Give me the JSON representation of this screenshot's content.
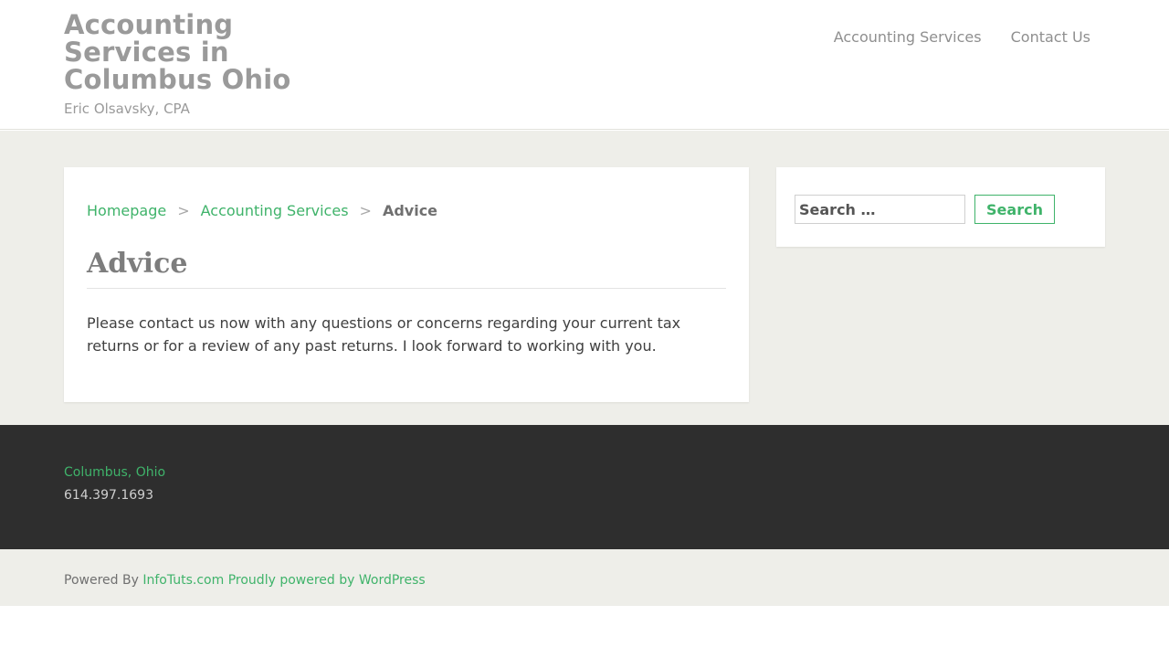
{
  "header": {
    "site_title": "Accounting Services in Columbus Ohio",
    "site_description": "Eric Olsavsky, CPA",
    "nav": [
      {
        "label": "Accounting Services"
      },
      {
        "label": "Contact Us"
      }
    ]
  },
  "breadcrumb": {
    "items": [
      "Homepage",
      "Accounting Services"
    ],
    "separator": ">",
    "current": "Advice"
  },
  "entry": {
    "title": "Advice",
    "content": "Please contact us now with any questions or concerns regarding your current tax returns or for a review of any past returns. I look forward to working with you."
  },
  "sidebar": {
    "search": {
      "placeholder": "Search …",
      "button_label": "Search"
    }
  },
  "footer": {
    "city": "Columbus, Ohio",
    "phone": "614.397.1693",
    "powered_prefix": "Powered By",
    "powered_link": "InfoTuts.com",
    "wordpress_link": "Proudly powered by WordPress"
  },
  "colors": {
    "accent": "#3fb36a",
    "content_bg": "#eeeee9",
    "footer_bg": "#2e2e2e"
  }
}
